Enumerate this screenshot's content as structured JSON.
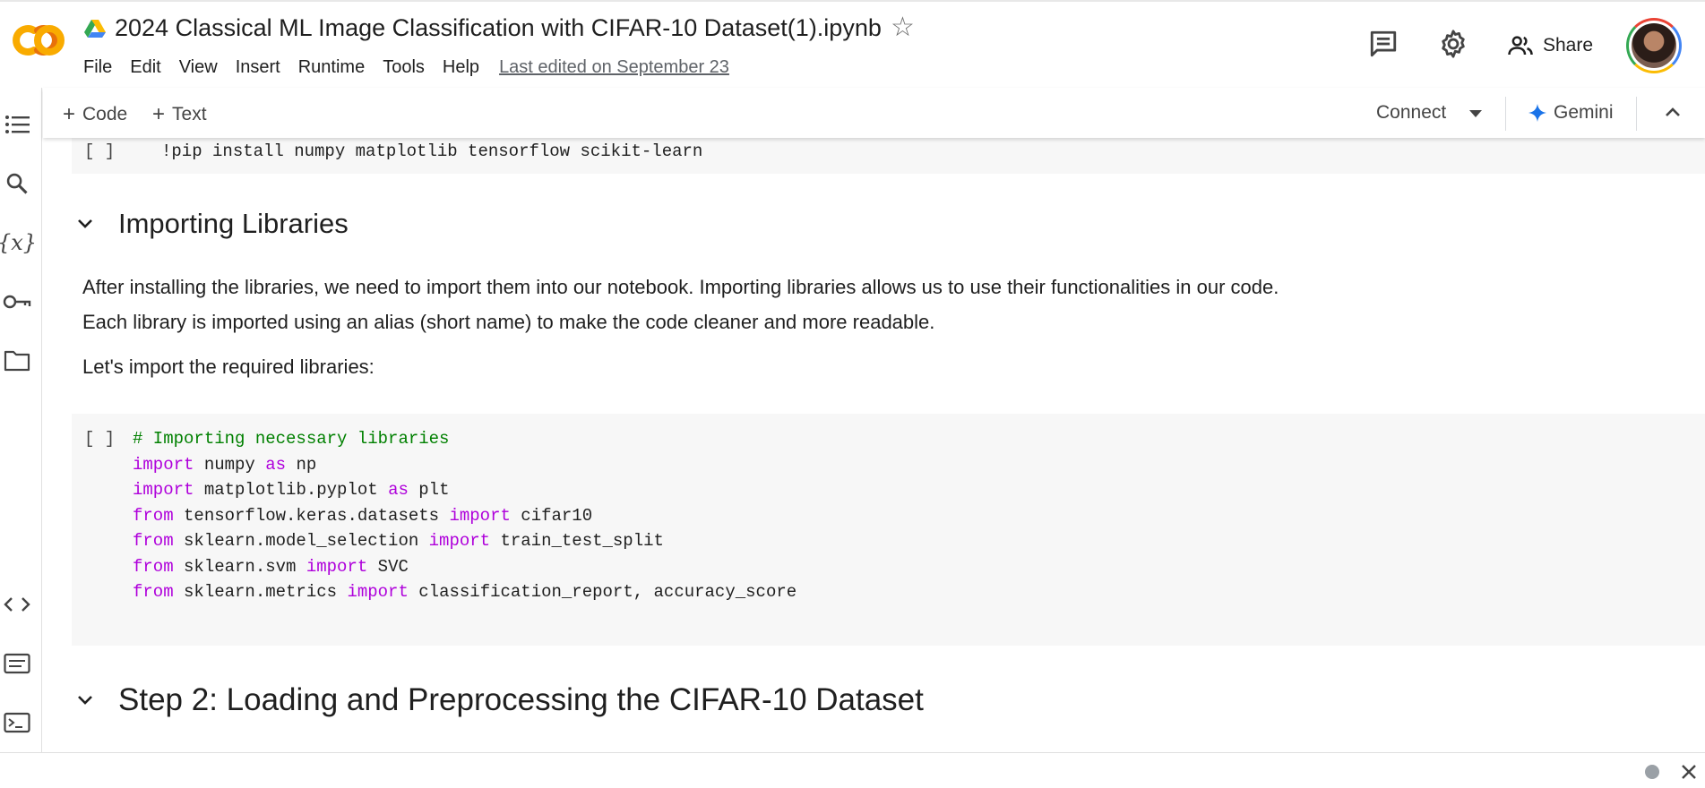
{
  "header": {
    "title": "2024 Classical ML Image Classification with CIFAR-10 Dataset(1).ipynb",
    "menu": [
      "File",
      "Edit",
      "View",
      "Insert",
      "Runtime",
      "Tools",
      "Help"
    ],
    "last_edited": "Last edited on September 23",
    "share_label": "Share"
  },
  "toolbar": {
    "add_code": "Code",
    "add_text": "Text",
    "connect": "Connect",
    "gemini": "Gemini"
  },
  "cells": {
    "pip_bracket": "[ ]",
    "pip_cmd": "!pip install numpy matplotlib tensorflow scikit-learn",
    "heading1": "Importing Libraries",
    "para1_line1": "After installing the libraries, we need to import them into our notebook. Importing libraries allows us to use their functionalities in our code.",
    "para1_line2": "Each library is imported using an alias (short name) to make the code cleaner and more readable.",
    "para2": "Let's import the required libraries:",
    "code_bracket": "[ ]",
    "code_comment": "# Importing necessary libraries",
    "heading2": "Step 2: Loading and Preprocessing the CIFAR-10 Dataset"
  },
  "code_tokens": {
    "import": "import",
    "as": "as",
    "from": "from",
    "numpy": " numpy ",
    "np": " np",
    "pyplot": " matplotlib.pyplot ",
    "plt": " plt",
    "keras": " tensorflow.keras.datasets ",
    "cifar10": " cifar10",
    "model_selection": " sklearn.model_selection ",
    "tts": " train_test_split",
    "svm": " sklearn.svm ",
    "svc": " SVC",
    "metrics": " sklearn.metrics ",
    "metrics_names": " classification_report, accuracy_score"
  },
  "icons": {
    "logo": "colab-logo",
    "drive": "google-drive-icon",
    "left_sidebar": [
      "table-of-contents-icon",
      "search-icon",
      "variables-icon",
      "secrets-key-icon",
      "files-folder-icon",
      "code-snippets-icon",
      "command-palette-icon",
      "terminal-icon"
    ]
  },
  "colors": {
    "keyword": "#af00db",
    "comment": "#008000",
    "code_bg": "#f7f7f7",
    "colab_orange": "#f9ab00",
    "gemini_blue": "#1a73e8"
  }
}
